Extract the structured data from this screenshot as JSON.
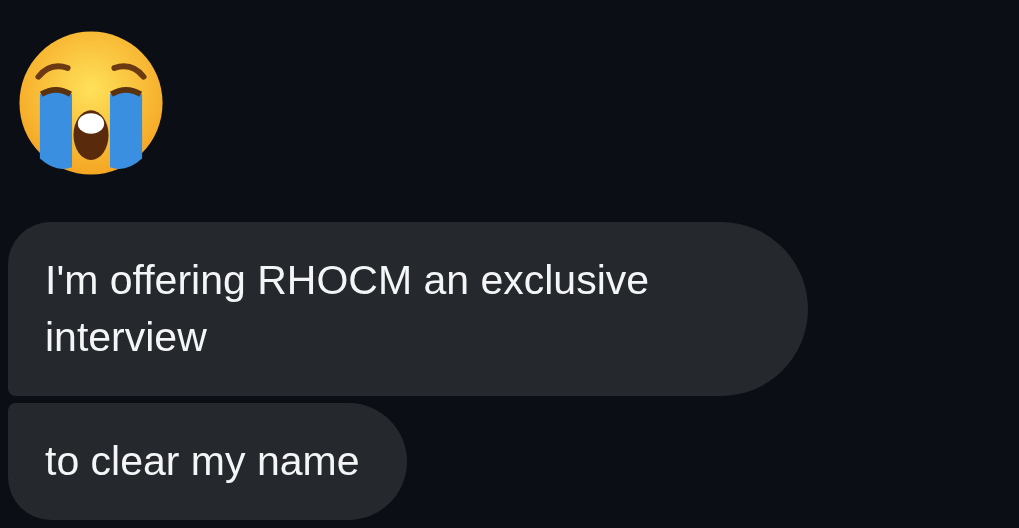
{
  "messages": [
    {
      "kind": "emoji"
    },
    {
      "kind": "first",
      "text": "I'm offering RHOCM an exclusive interview"
    },
    {
      "kind": "last",
      "text": "to clear my name"
    }
  ]
}
